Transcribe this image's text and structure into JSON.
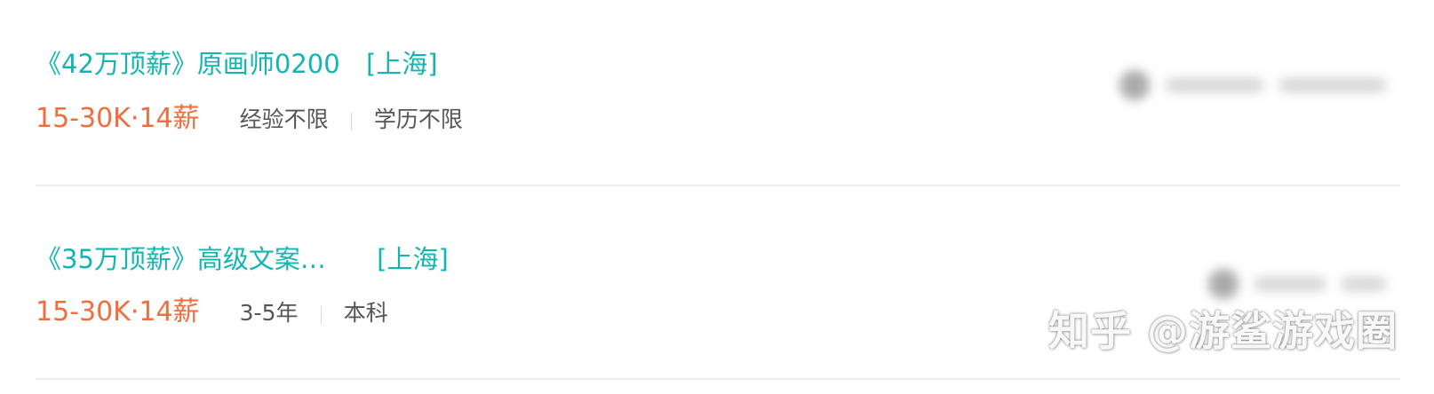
{
  "jobs": [
    {
      "title": "《42万顶薪》原画师0200",
      "location": "[上海]",
      "salary": "15-30K·14薪",
      "tags": [
        "经验不限",
        "学历不限"
      ]
    },
    {
      "title": "《35万顶薪》高级文案…",
      "location": "[上海]",
      "salary": "15-30K·14薪",
      "tags": [
        "3-5年",
        "本科"
      ]
    }
  ],
  "colors": {
    "title": "#13b5b1",
    "salary": "#f26d3d",
    "tag": "#555555",
    "divider": "#ededed"
  },
  "watermark": "知乎 @游鲨游戏圈"
}
